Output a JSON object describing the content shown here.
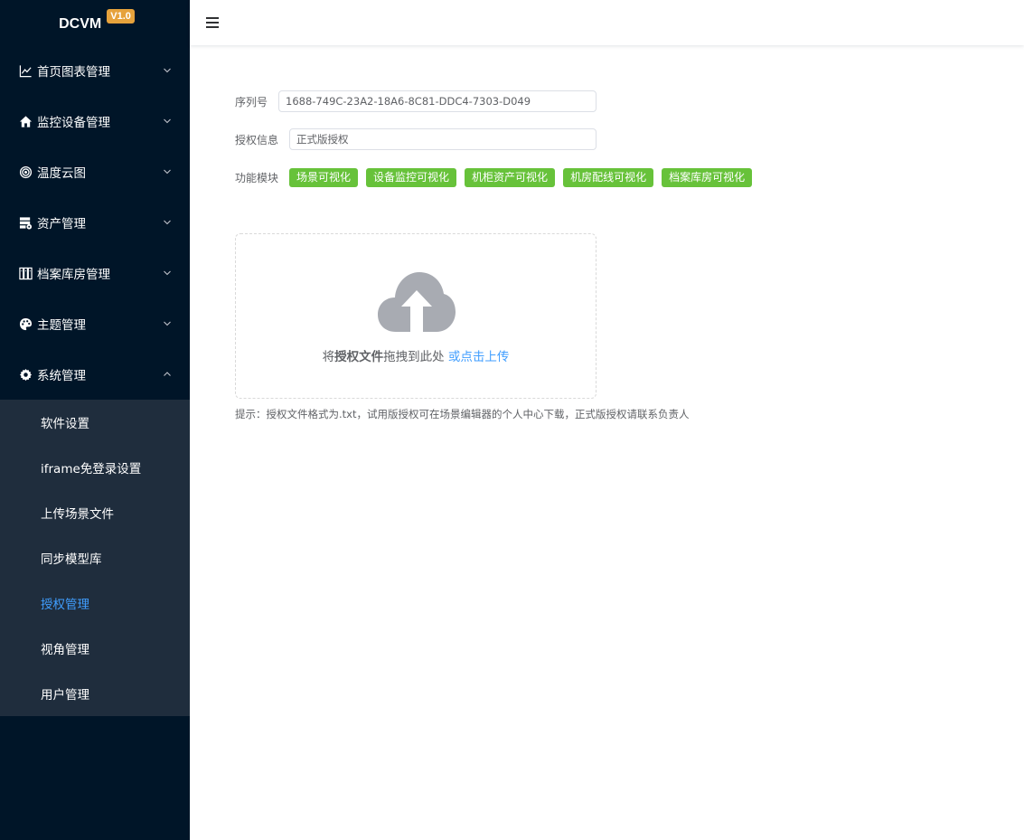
{
  "brand": {
    "name": "DCVM",
    "version": "V1.0"
  },
  "sidebar": {
    "items": [
      {
        "label": "首页图表管理",
        "icon": "line-chart-icon"
      },
      {
        "label": "监控设备管理",
        "icon": "home-icon"
      },
      {
        "label": "温度云图",
        "icon": "target-icon"
      },
      {
        "label": "资产管理",
        "icon": "server-settings-icon"
      },
      {
        "label": "档案库房管理",
        "icon": "archive-icon"
      },
      {
        "label": "主题管理",
        "icon": "palette-icon"
      },
      {
        "label": "系统管理",
        "icon": "gear-icon",
        "expanded": true
      }
    ],
    "submenu": [
      {
        "label": "软件设置"
      },
      {
        "label": "iframe免登录设置"
      },
      {
        "label": "上传场景文件"
      },
      {
        "label": "同步模型库"
      },
      {
        "label": "授权管理",
        "active": true
      },
      {
        "label": "视角管理"
      },
      {
        "label": "用户管理"
      }
    ]
  },
  "form": {
    "serial_label": "序列号",
    "serial_value": "1688-749C-23A2-18A6-8C81-DDC4-7303-D049",
    "license_label": "授权信息",
    "license_value": "正式版授权",
    "modules_label": "功能模块",
    "modules": [
      "场景可视化",
      "设备监控可视化",
      "机柜资产可视化",
      "机房配线可视化",
      "档案库房可视化"
    ]
  },
  "upload": {
    "text_prefix": "将",
    "text_bold": "授权文件",
    "text_suffix": "拖拽到此处",
    "link": "或点击上传",
    "tip": "提示：授权文件格式为.txt，试用版授权可在场景编辑器的个人中心下载，正式版授权请联系负责人"
  },
  "colors": {
    "sidebar_bg": "#001528",
    "submenu_bg": "#1f2d3d",
    "active": "#409eff",
    "tag": "#67c23a",
    "version_badge": "#e6a23c"
  }
}
